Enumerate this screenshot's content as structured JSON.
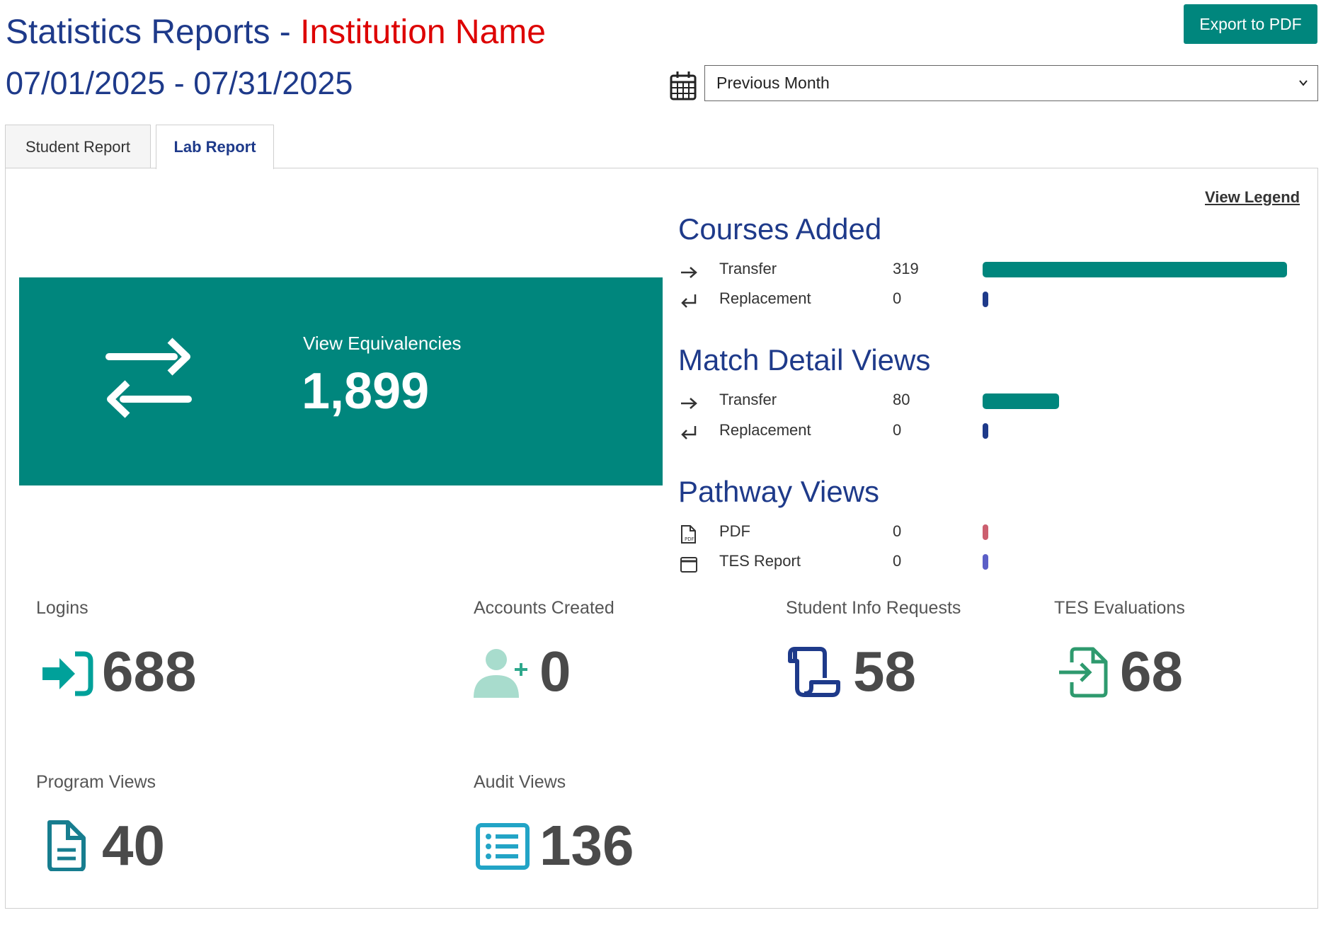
{
  "header": {
    "title": "Statistics Reports -",
    "institution": "Institution Name",
    "date_range": "07/01/2025 - 07/31/2025",
    "export_label": "Export to PDF",
    "period_select": "Previous Month"
  },
  "tabs": [
    {
      "label": "Student Report",
      "active": false
    },
    {
      "label": "Lab Report",
      "active": true
    }
  ],
  "legend_link": "View Legend",
  "equivalencies": {
    "label": "View Equivalencies",
    "value": "1,899",
    "icon": "swap-arrows-icon"
  },
  "courses_added": {
    "title": "Courses Added",
    "rows": [
      {
        "label": "Transfer",
        "value": 319,
        "icon": "arrow-right-icon",
        "color": "#00867d"
      },
      {
        "label": "Replacement",
        "value": 0,
        "icon": "return-arrow-icon",
        "color": "#1e3a8a"
      }
    ]
  },
  "match_detail_views": {
    "title": "Match Detail Views",
    "rows": [
      {
        "label": "Transfer",
        "value": 80,
        "icon": "arrow-right-icon",
        "color": "#00867d"
      },
      {
        "label": "Replacement",
        "value": 0,
        "icon": "return-arrow-icon",
        "color": "#1e3a8a"
      }
    ]
  },
  "pathway_views": {
    "title": "Pathway Views",
    "rows": [
      {
        "label": "PDF",
        "value": 0,
        "icon": "pdf-file-icon",
        "color": "#cc5f6f"
      },
      {
        "label": "TES Report",
        "value": 0,
        "icon": "window-icon",
        "color": "#5b5fc7"
      }
    ]
  },
  "stats": [
    {
      "label": "Logins",
      "value": "688",
      "icon": "login-icon",
      "color": "#00a19a"
    },
    {
      "label": "Accounts Created",
      "value": "0",
      "icon": "add-user-icon",
      "color": "#a8dccd"
    },
    {
      "label": "Student Info Requests",
      "value": "58",
      "icon": "scroll-icon",
      "color": "#1e3a8a"
    },
    {
      "label": "TES Evaluations",
      "value": "68",
      "icon": "file-import-icon",
      "color": "#2e9a6e"
    },
    {
      "label": "Program Views",
      "value": "40",
      "icon": "document-icon",
      "color": "#177d8f"
    },
    {
      "label": "Audit Views",
      "value": "136",
      "icon": "list-icon",
      "color": "#22a4c6"
    }
  ]
}
